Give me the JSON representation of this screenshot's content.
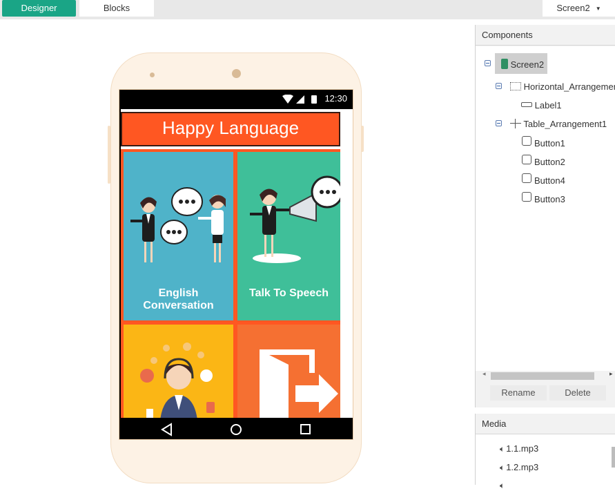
{
  "topbar": {
    "designer_label": "Designer",
    "blocks_label": "Blocks",
    "screen_select": "Screen2"
  },
  "phone": {
    "status_time": "12:30",
    "app_title": "Happy Language",
    "buttons": [
      {
        "label": "English Conversation",
        "color": "#4fb3c9"
      },
      {
        "label": "Talk To Speech",
        "color": "#3fbf99"
      },
      {
        "label": "",
        "color": "#fbb615"
      },
      {
        "label": "",
        "color": "#f57032"
      }
    ]
  },
  "components": {
    "title": "Components",
    "tree": [
      {
        "label": "Screen2",
        "icon": "phone-icon"
      },
      {
        "label": "Horizontal_Arrangemen",
        "icon": "horizontal-arrangement-icon"
      },
      {
        "label": "Label1",
        "icon": "label-icon"
      },
      {
        "label": "Table_Arrangement1",
        "icon": "table-arrangement-icon"
      },
      {
        "label": "Button1",
        "icon": "button-icon"
      },
      {
        "label": "Button2",
        "icon": "button-icon"
      },
      {
        "label": "Button4",
        "icon": "button-icon"
      },
      {
        "label": "Button3",
        "icon": "button-icon"
      }
    ],
    "rename_label": "Rename",
    "delete_label": "Delete"
  },
  "media": {
    "title": "Media",
    "items": [
      "1.1.mp3",
      "1.2.mp3"
    ]
  },
  "colors": {
    "accent": "#1aa586",
    "header": "#ff5722"
  }
}
